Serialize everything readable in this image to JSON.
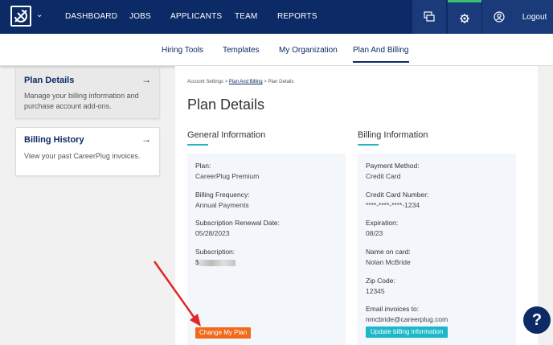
{
  "topnav": {
    "links": [
      "DASHBOARD",
      "JOBS",
      "APPLICANTS",
      "TEAM",
      "REPORTS"
    ],
    "logout": "Logout"
  },
  "subnav": {
    "links": [
      "Hiring Tools",
      "Templates",
      "My Organization",
      "Plan And Billing"
    ]
  },
  "sidebar": {
    "items": [
      {
        "title": "Plan Details",
        "desc": "Manage your billing information and purchase account add-ons."
      },
      {
        "title": "Billing History",
        "desc": "View your past CareerPlug invoices."
      }
    ]
  },
  "breadcrumb": {
    "a": "Account Settings",
    "sep1": ">",
    "b": "Plan And Billing",
    "sep2": ">",
    "c": "Plan Details"
  },
  "page": {
    "title": "Plan Details"
  },
  "general": {
    "title": "General Information",
    "plan_label": "Plan:",
    "plan_value": "CareerPlug Premium",
    "freq_label": "Billing Frequency:",
    "freq_value": "Annual Payments",
    "renewal_label": "Subscription Renewal Date:",
    "renewal_value": "05/28/2023",
    "sub_label": "Subscription:",
    "sub_value": "$",
    "button": "Change My Plan"
  },
  "billing": {
    "title": "Billing Information",
    "method_label": "Payment Method:",
    "method_value": "Credit Card",
    "cc_label": "Credit Card Number:",
    "cc_value": "****-****-****-1234",
    "exp_label": "Expiration:",
    "exp_value": "08/23",
    "name_label": "Name on card:",
    "name_value": "Nolan McBride",
    "zip_label": "Zip Code:",
    "zip_value": "12345",
    "email_label": "Email invoices to:",
    "email_value": "nmcbride@careerplug.com",
    "button": "Update billing information"
  },
  "help": {
    "label": "?"
  },
  "colors": {
    "navy": "#0c2a66",
    "teal": "#1cb8c9",
    "orange": "#f06a1a",
    "arrow": "#e0262b"
  }
}
